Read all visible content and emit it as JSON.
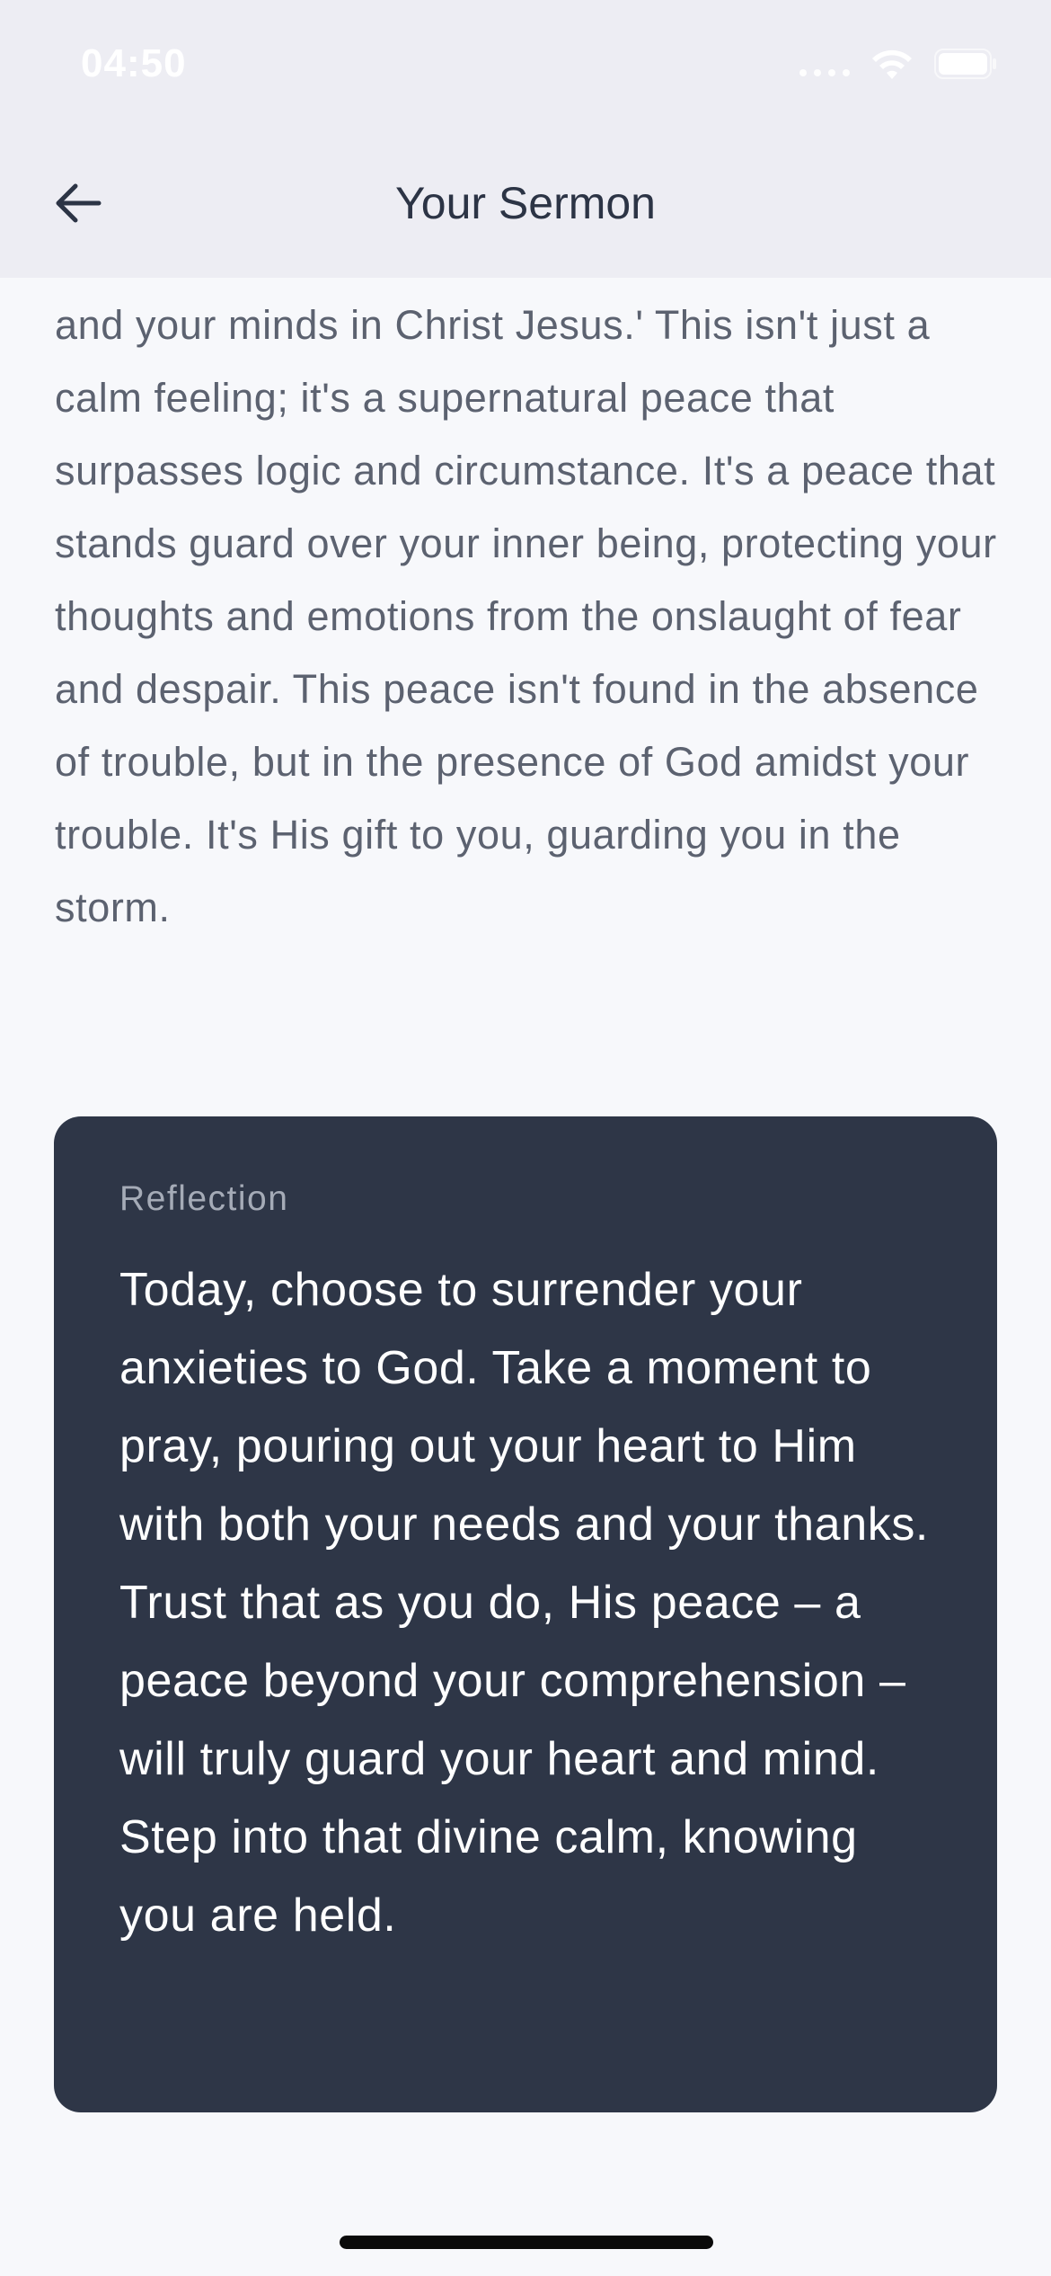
{
  "status_bar": {
    "time": "04:50"
  },
  "nav": {
    "title": "Your Sermon",
    "back_icon": "arrow-left-icon"
  },
  "sermon": {
    "text": "transcends all understanding, will guard your hearts and your minds in Christ Jesus.' This isn't just a calm feeling; it's a supernatural peace that surpasses logic and circumstance. It's a peace that stands guard over your inner being, protecting your thoughts and emotions from the onslaught of fear and despair. This peace isn't found in the absence of trouble, but in the presence of God amidst your trouble. It's His gift to you, guarding you in the storm."
  },
  "reflection": {
    "label": "Reflection",
    "text": "Today, choose to surrender your anxieties to God. Take a moment to pray, pouring out your heart to Him with both your needs and your thanks. Trust that as you do, His peace – a peace beyond your comprehension – will truly guard your heart and mind. Step into that divine calm, knowing you are held."
  },
  "colors": {
    "background": "#f7f8fb",
    "header": "#ededf3",
    "card": "#2e3647",
    "body_text": "#5c6270",
    "title_text": "#2c3445"
  }
}
